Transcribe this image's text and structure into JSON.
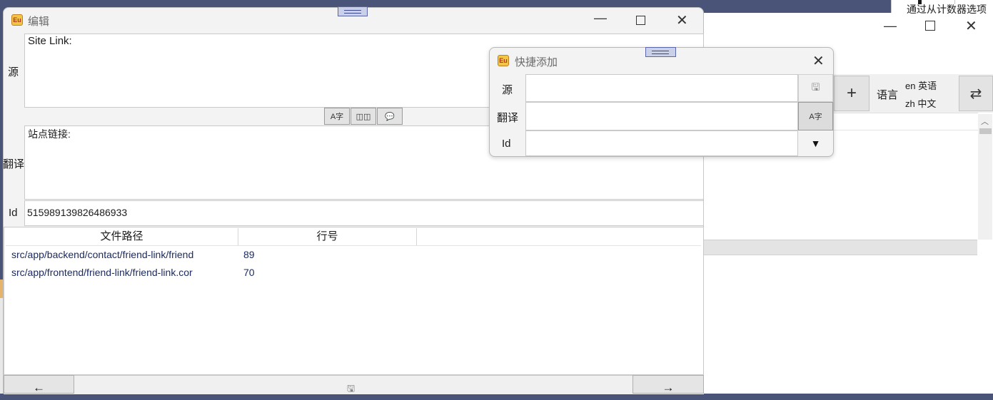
{
  "background_window": {
    "strip_text": "通过从计数器选项",
    "min_icon": "—",
    "close_icon": "✕",
    "add_icon": "+",
    "language_label": "语言",
    "language_options": [
      "en 英语",
      "zh 中文"
    ],
    "swap_icon": "⇄",
    "scroll_up_icon": "︿"
  },
  "editor": {
    "title": "编辑",
    "min_icon": "—",
    "close_icon": "✕",
    "source_label": "源",
    "source_text": "Site Link:",
    "translation_label": "翻译",
    "translation_text": "站点链接:",
    "id_label": "Id",
    "id_value": "515989139826486933",
    "tool_icons": {
      "translate": "A字",
      "book": "◫◫",
      "comment": "💬"
    },
    "table": {
      "columns": [
        "文件路径",
        "行号"
      ],
      "rows": [
        {
          "path": "src/app/backend/contact/friend-link/friend",
          "line": "89"
        },
        {
          "path": "src/app/frontend/friend-link/friend-link.cor",
          "line": "70"
        }
      ]
    },
    "prev_icon": "←",
    "save_icon": "🖫",
    "next_icon": "→"
  },
  "quick_add": {
    "title": "快捷添加",
    "close_icon": "✕",
    "source_label": "源",
    "translation_label": "翻译",
    "id_label": "Id",
    "source_value": "",
    "translation_value": "",
    "id_value": "",
    "save_icon": "🖫",
    "translate_icon": "A字",
    "dropdown_icon": "▼"
  }
}
